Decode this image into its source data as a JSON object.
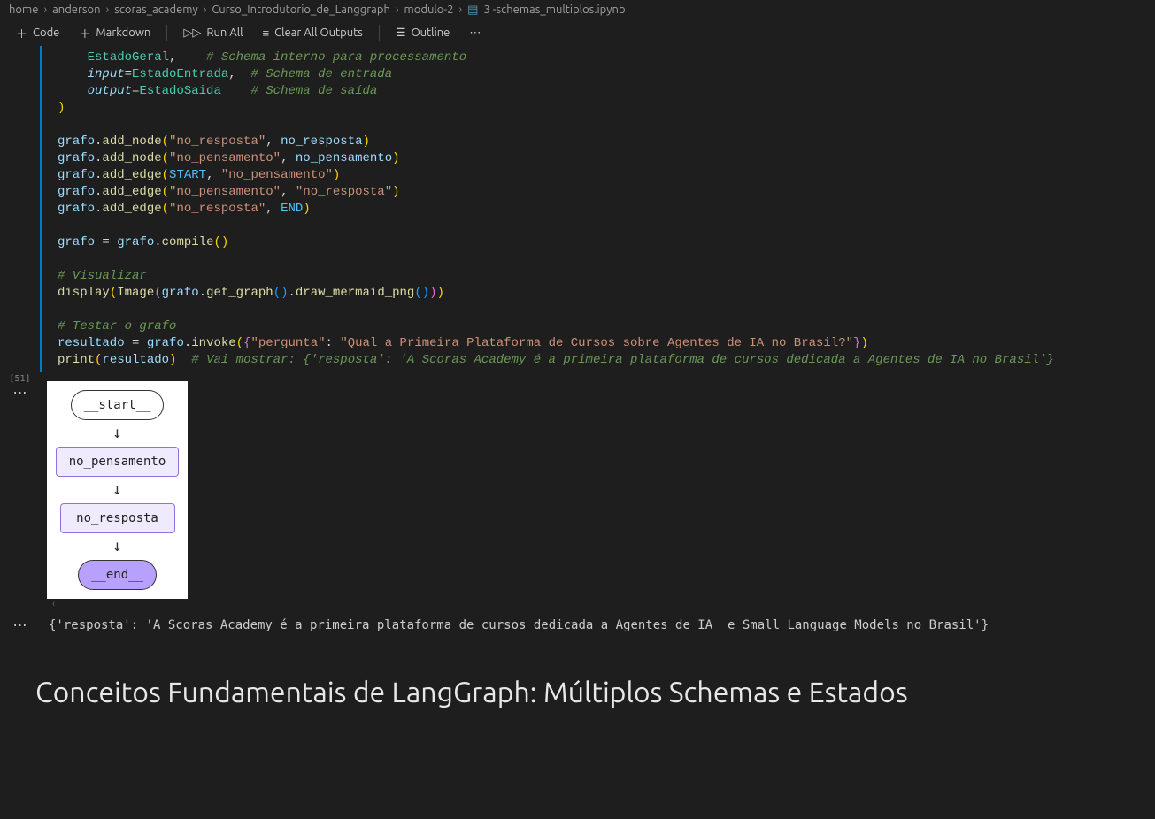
{
  "breadcrumb": {
    "parts": [
      "home",
      "anderson",
      "scoras_academy",
      "Curso_Introdutorio_de_Langgraph",
      "modulo-2"
    ],
    "file": "3 -schemas_multiplos.ipynb"
  },
  "toolbar": {
    "code": "Code",
    "markdown": "Markdown",
    "runAll": "Run All",
    "clearAll": "Clear All Outputs",
    "outline": "Outline"
  },
  "codeCell": {
    "execCount": "[51]",
    "code": {
      "l1a": "EstadoGeral",
      "l1c": "# Schema interno para processamento",
      "l2a": "input",
      "l2b": "EstadoEntrada",
      "l2c": "# Schema de entrada",
      "l3a": "output",
      "l3b": "EstadoSaida",
      "l3c": "# Schema de saída",
      "grafo": "grafo",
      "addNode": "add_node",
      "addEdge": "add_edge",
      "compile": "compile",
      "noResposta": "no_resposta",
      "noRespostaStr": "\"no_resposta\"",
      "noPensamento": "no_pensamento",
      "noPensamentoStr": "\"no_pensamento\"",
      "START": "START",
      "END": "END",
      "cViz": "# Visualizar",
      "display": "display",
      "Image": "Image",
      "getGraph": "get_graph",
      "drawPng": "draw_mermaid_png",
      "cTest": "# Testar o grafo",
      "resultado": "resultado",
      "invoke": "invoke",
      "pergKey": "\"pergunta\"",
      "pergVal": "\"Qual a Primeira Plataforma de Cursos sobre Agentes de IA no Brasil?\"",
      "print": "print",
      "cResult": "# Vai mostrar: {'resposta': 'A Scoras Academy é a primeira plataforma de cursos dedicada a Agentes de IA no Brasil'}"
    }
  },
  "graphOutput": {
    "start": "__start__",
    "n1": "no_pensamento",
    "n2": "no_resposta",
    "end": "__end__"
  },
  "textOutput": "{'resposta': 'A Scoras Academy é a primeira plataforma de cursos dedicada a Agentes de IA  e Small Language Models no Brasil'}",
  "markdown": {
    "heading": "Conceitos Fundamentais de LangGraph: Múltiplos Schemas e Estados"
  }
}
